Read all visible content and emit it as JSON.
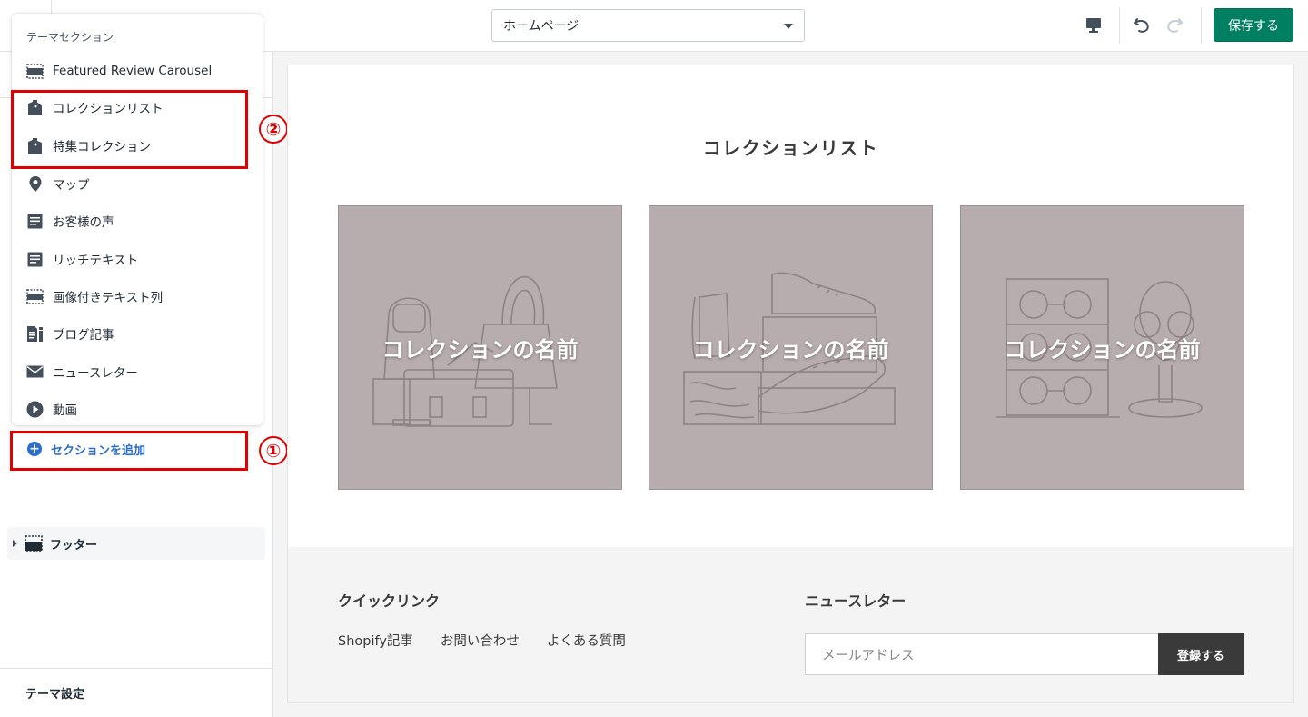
{
  "topbar": {
    "page_selector": "ホームページ",
    "save_label": "保存する"
  },
  "sidebar": {
    "popover": {
      "heading": "テーマセクション",
      "items": [
        {
          "label": "Featured Review Carousel",
          "icon": "section-image-icon"
        },
        {
          "label": "コレクションリスト",
          "icon": "collection-tag-icon"
        },
        {
          "label": "特集コレクション",
          "icon": "collection-tag-icon"
        },
        {
          "label": "マップ",
          "icon": "map-pin-icon"
        },
        {
          "label": "お客様の声",
          "icon": "text-block-icon"
        },
        {
          "label": "リッチテキスト",
          "icon": "text-block-icon"
        },
        {
          "label": "画像付きテキスト列",
          "icon": "section-image-icon"
        },
        {
          "label": "ブログ記事",
          "icon": "blog-icon"
        },
        {
          "label": "ニュースレター",
          "icon": "envelope-icon"
        },
        {
          "label": "動画",
          "icon": "play-icon"
        }
      ]
    },
    "add_section_label": "セクションを追加",
    "footer_label": "フッター",
    "theme_settings_label": "テーマ設定"
  },
  "annotations": {
    "one": "①",
    "two": "②",
    "color": "#e00000"
  },
  "preview": {
    "collection_list_title": "コレクションリスト",
    "cards": [
      {
        "name": "コレクションの名前"
      },
      {
        "name": "コレクションの名前"
      },
      {
        "name": "コレクションの名前"
      }
    ],
    "footer": {
      "quicklinks_title": "クイックリンク",
      "links": [
        "Shopify記事",
        "お問い合わせ",
        "よくある質問"
      ],
      "newsletter_title": "ニュースレター",
      "email_placeholder": "メールアドレス",
      "subscribe_label": "登録する"
    }
  },
  "colors": {
    "save_button": "#008060",
    "link_blue": "#2c6ecb",
    "card_bg": "#b8adae"
  }
}
